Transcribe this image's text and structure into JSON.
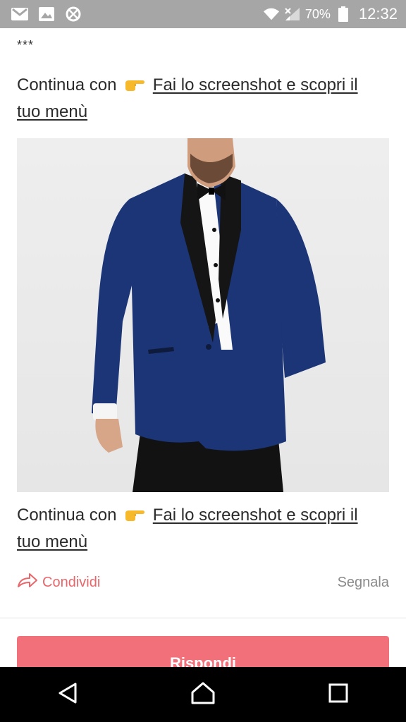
{
  "status_bar": {
    "battery_percent": "70%",
    "time": "12:32",
    "icons": [
      "gmail-icon",
      "gallery-icon",
      "data-saver-icon",
      "wifi-icon",
      "signal-icon",
      "battery-icon"
    ]
  },
  "post": {
    "separator": "***",
    "paragraphs": [
      {
        "prefix": "Continua con",
        "emoji": "backhand-index-pointing-right",
        "link": "Fai lo screenshot e scopri il tuo menù"
      },
      {
        "prefix": "Continua con",
        "emoji": "backhand-index-pointing-right",
        "link": "Fai lo screenshot e scopri il tuo menù"
      }
    ],
    "image_subject": "man in blue tuxedo jacket with black lapels and bow tie"
  },
  "actions": {
    "share_label": "Condividi",
    "report_label": "Segnala"
  },
  "reply_button": {
    "label": "Rispondi"
  },
  "colors": {
    "accent": "#f2707a",
    "share": "#e8676b",
    "status_bar": "#a6a6a6",
    "nav_bar": "#000000",
    "jacket": "#1c3577"
  },
  "nav_bar": {
    "buttons": [
      "back-icon",
      "home-icon",
      "recents-icon"
    ]
  }
}
